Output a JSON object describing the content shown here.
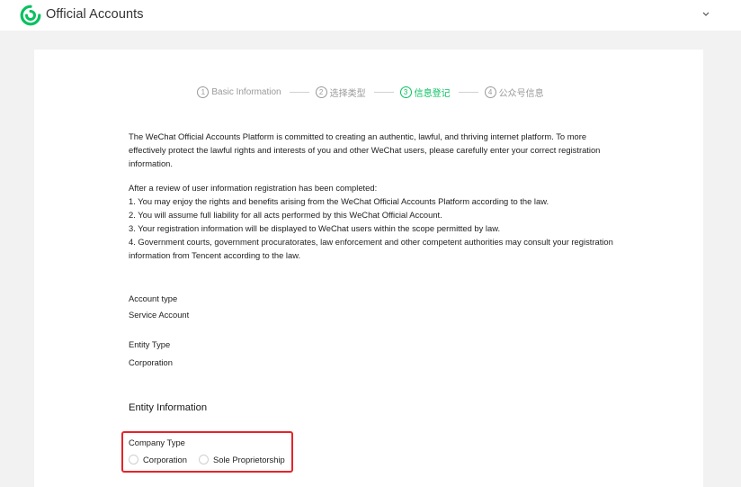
{
  "header": {
    "app_title": "Official Accounts",
    "logo_icon": "wechat-logo-icon",
    "menu_icon": "chevron-down-icon",
    "accent": "#07c160"
  },
  "steps": [
    {
      "num": "1",
      "label": "Basic Information",
      "active": false
    },
    {
      "num": "2",
      "label": "选择类型",
      "active": false
    },
    {
      "num": "3",
      "label": "信息登记",
      "active": true
    },
    {
      "num": "4",
      "label": "公众号信息",
      "active": false
    }
  ],
  "intro": {
    "paragraph1": "The WeChat Official Accounts Platform is committed to creating an authentic, lawful, and thriving internet platform. To more effectively protect the lawful rights and interests of you and other WeChat users, please carefully enter your correct registration information.",
    "review_heading": "After a review of user information registration has been completed:",
    "points": [
      "1. You may enjoy the rights and benefits arising from the WeChat Official Accounts Platform according to the law.",
      "2. You will assume full liability for all acts performed by this WeChat Official Account.",
      "3. Your registration information will be displayed to WeChat users within the scope permitted by law.",
      "4. Government courts, government procuratorates, law enforcement and other competent authorities may consult your registration information from Tencent according to the law."
    ]
  },
  "account": {
    "type_label": "Account type",
    "type_value": "Service Account",
    "entity_label": "Entity Type",
    "entity_value": "Corporation"
  },
  "entity_info": {
    "section_title": "Entity Information",
    "company_type_label": "Company Type",
    "options": [
      "Corporation",
      "Sole Proprietorship"
    ],
    "highlight_color": "#e5242b"
  }
}
